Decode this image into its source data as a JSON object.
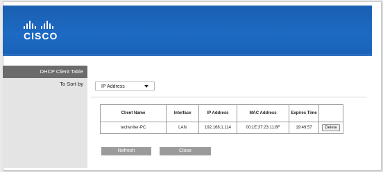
{
  "brand": {
    "logo_text": "CISCO",
    "colors": {
      "header": "#1a5fb1",
      "sidebar_title": "#6b6b6b",
      "button": "#9b9b9b"
    }
  },
  "sidebar": {
    "title": "DHCP Client Table",
    "sort_label": "To Sort by"
  },
  "sort": {
    "selected": "IP Address"
  },
  "table": {
    "headers": [
      "Client Name",
      "Interface",
      "IP Address",
      "MAC Address",
      "Expires Time",
      ""
    ],
    "rows": [
      {
        "client_name": "techwriter-PC",
        "interface": "LAN",
        "ip": "192.168.1.114",
        "mac": "00:1E:37:23:11:8F",
        "expires": "19:49:57",
        "action": "Delete"
      }
    ]
  },
  "buttons": {
    "refresh": "Refresh",
    "close": "Close"
  }
}
